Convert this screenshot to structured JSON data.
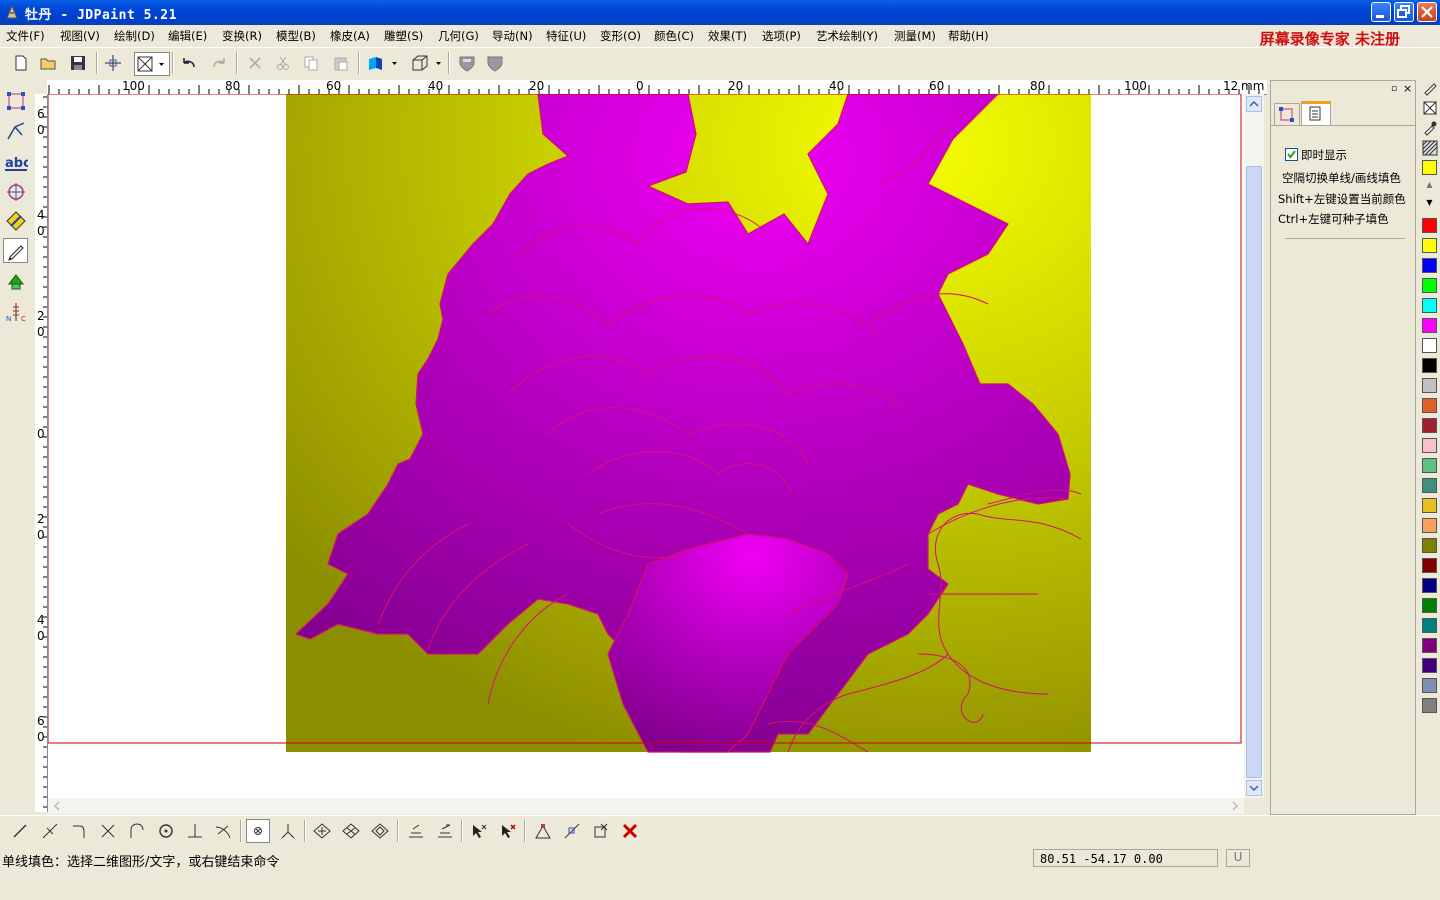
{
  "window": {
    "title": "牡丹 - JDPaint 5.21"
  },
  "menu": [
    "文件(F)",
    "视图(V)",
    "绘制(D)",
    "编辑(E)",
    "变换(R)",
    "模型(B)",
    "橡皮(A)",
    "雕塑(S)",
    "几何(G)",
    "导动(N)",
    "特征(U)",
    "变形(O)",
    "颜色(C)",
    "效果(T)",
    "选项(P)",
    "艺术绘制(Y)",
    "测量(M)",
    "帮助(H)"
  ],
  "watermark": "屏幕录像专家 未注册",
  "ruler": {
    "h_labels": [
      "100",
      "80",
      "60",
      "40",
      "20",
      "0",
      "20",
      "40",
      "60",
      "80",
      "100",
      "12",
      "mm"
    ],
    "v_labels": [
      "6",
      "0",
      "4",
      "0",
      "2",
      "0",
      "0",
      "2",
      "0",
      "4",
      "0",
      "6",
      "0"
    ]
  },
  "right_panel": {
    "checkbox_label": "即时显示",
    "checkbox_checked": true,
    "hints": [
      "空隔切换单线/画线填色",
      "Shift+左键设置当前颜色",
      "Ctrl+左键可种子填色"
    ]
  },
  "palette": [
    "#ffff00",
    "#ff0000",
    "#ffff00",
    "#0000ff",
    "#00ff00",
    "#00ffff",
    "#ff00ff",
    "#ffffff",
    "#000000",
    "#c0c0c0",
    "#e06030",
    "#a02030",
    "#f8c0c8",
    "#60c080",
    "#409080",
    "#e8c020",
    "#f8a060",
    "#808000",
    "#800000",
    "#000080",
    "#008000",
    "#008080",
    "#800080",
    "#400080",
    "#8090b0",
    "#808080"
  ],
  "status": {
    "message": "单线填色：选择二维图形/文字，或右键结束命令",
    "coords": "80.51 -54.17 0.00",
    "mode": "U"
  },
  "icons": {
    "toolbar": [
      "new-icon",
      "open-icon",
      "save-icon",
      "snap-icon",
      "select-box-icon",
      "undo-icon",
      "redo-icon",
      "delete-icon",
      "cut-icon",
      "copy-icon",
      "paste-icon",
      "shade-icon",
      "view-cube-icon",
      "shield-a-icon",
      "shield-b-icon"
    ],
    "left": [
      "node-edit-icon",
      "pen-line-icon",
      "text-abc-icon",
      "circle-icon",
      "diamond-icon",
      "pencil-icon",
      "fill-icon",
      "measure-icon"
    ]
  }
}
